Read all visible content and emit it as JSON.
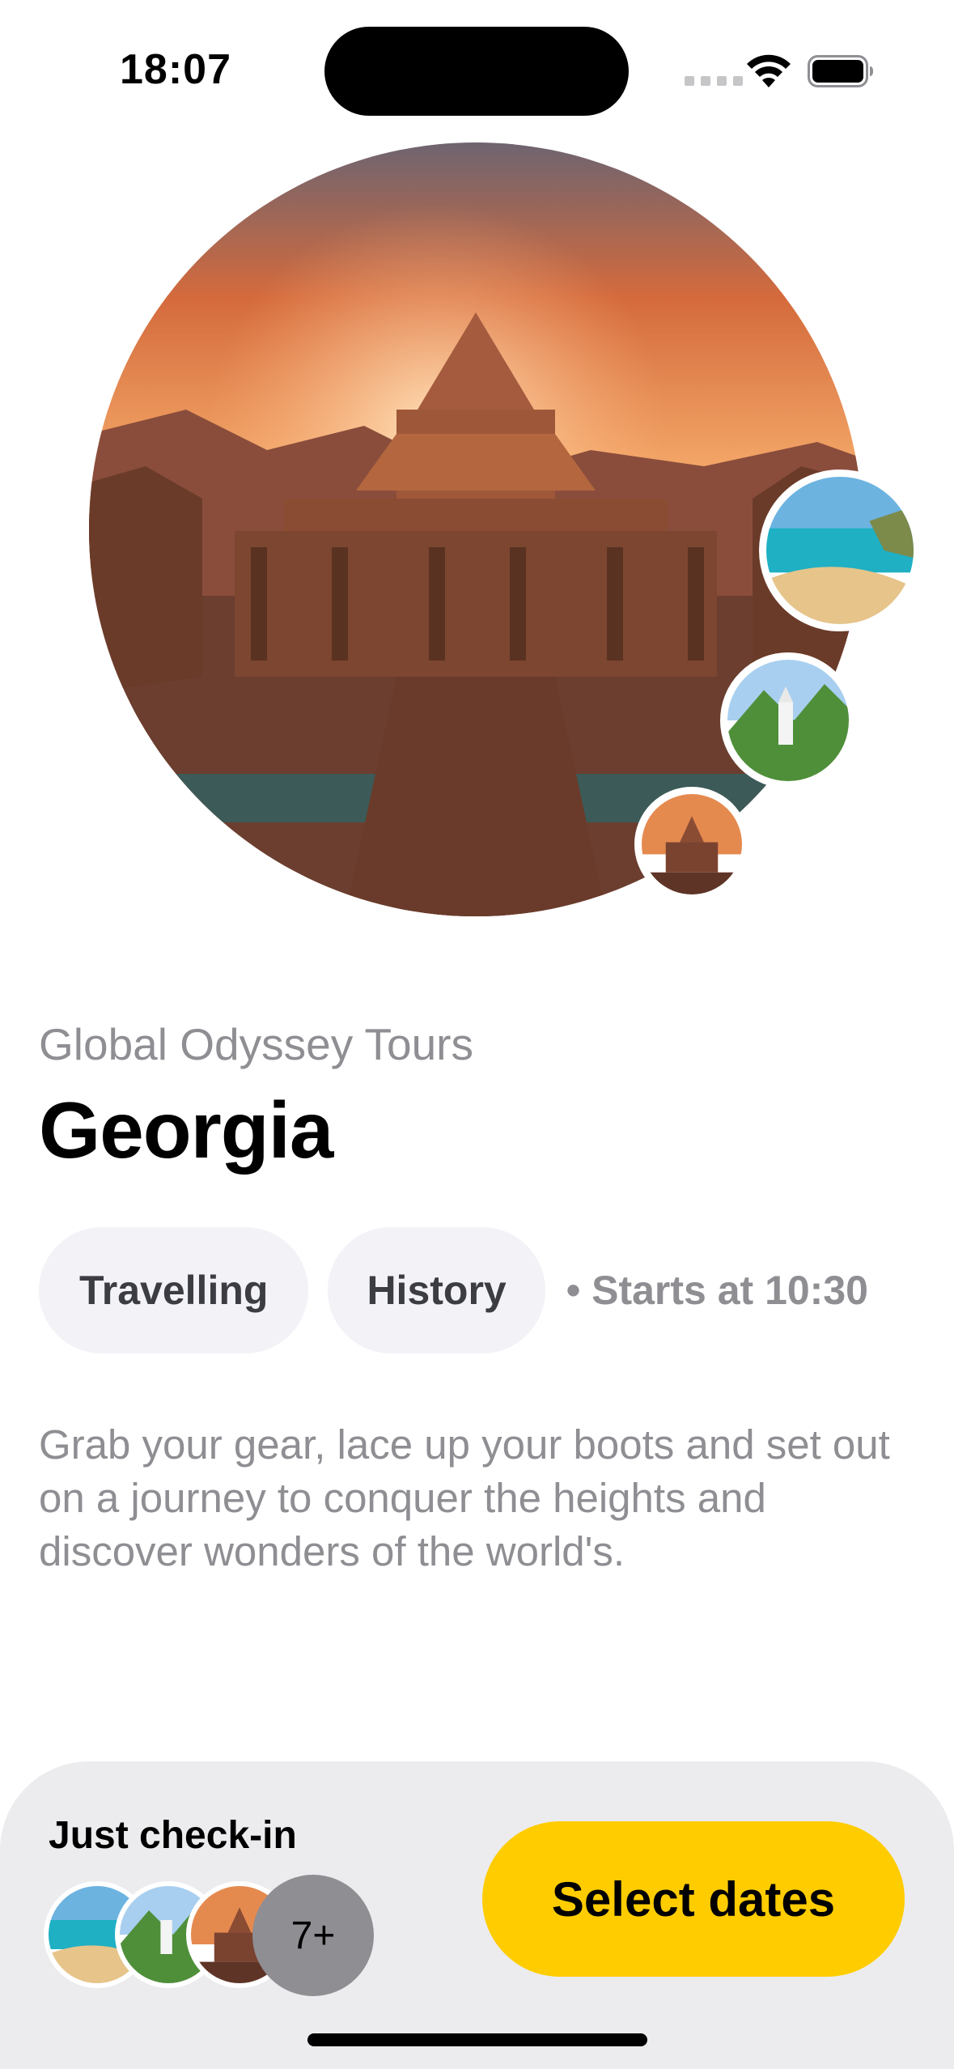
{
  "status_bar": {
    "time": "18:07"
  },
  "tour": {
    "organizer": "Global Odyssey Tours",
    "destination": "Georgia",
    "tags": [
      "Travelling",
      "History"
    ],
    "start_time": "• Starts at 10:30",
    "description": "Grab your gear, lace up your boots and set out on a journey to conquer the heights and discover wonders of the world's."
  },
  "bottom_bar": {
    "checkin_label": "Just check-in",
    "more_count": "7+",
    "cta_label": "Select dates"
  },
  "colors": {
    "accent": "#ffcc00",
    "chip_bg": "#f2f2f7",
    "secondary_text": "#8e8e93",
    "sheet_bg": "#ececee"
  }
}
